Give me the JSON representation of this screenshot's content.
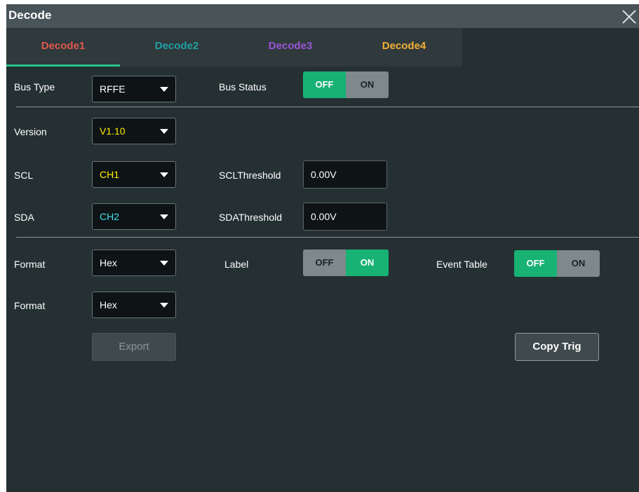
{
  "window": {
    "title": "Decode"
  },
  "tabs": [
    {
      "label": "Decode1",
      "color": "#e0594f",
      "active": true
    },
    {
      "label": "Decode2",
      "color": "#1fa2a5",
      "active": false
    },
    {
      "label": "Decode3",
      "color": "#9a57d9",
      "active": false
    },
    {
      "label": "Decode4",
      "color": "#f2b135",
      "active": false
    }
  ],
  "colors": {
    "accent_on": "#17b274",
    "ch1": "#ffee00",
    "ch2": "#3fe0ea",
    "version": "#ffee00"
  },
  "bus": {
    "type_label": "Bus Type",
    "type_value": "RFFE",
    "status_label": "Bus Status",
    "status_off": "OFF",
    "status_on": "ON",
    "status_selected": "OFF"
  },
  "version": {
    "label": "Version",
    "value": "V1.10"
  },
  "scl": {
    "label": "SCL",
    "value": "CH1",
    "threshold_label": "SCLThreshold",
    "threshold_value": "0.00V"
  },
  "sda": {
    "label": "SDA",
    "value": "CH2",
    "threshold_label": "SDAThreshold",
    "threshold_value": "0.00V"
  },
  "format1": {
    "label": "Format",
    "value": "Hex"
  },
  "label_toggle": {
    "label": "Label",
    "off": "OFF",
    "on": "ON",
    "selected": "ON"
  },
  "event_table": {
    "label": "Event Table",
    "off": "OFF",
    "on": "ON",
    "selected": "OFF"
  },
  "format2": {
    "label": "Format",
    "value": "Hex"
  },
  "buttons": {
    "export": "Export",
    "copy_trig": "Copy Trig"
  }
}
